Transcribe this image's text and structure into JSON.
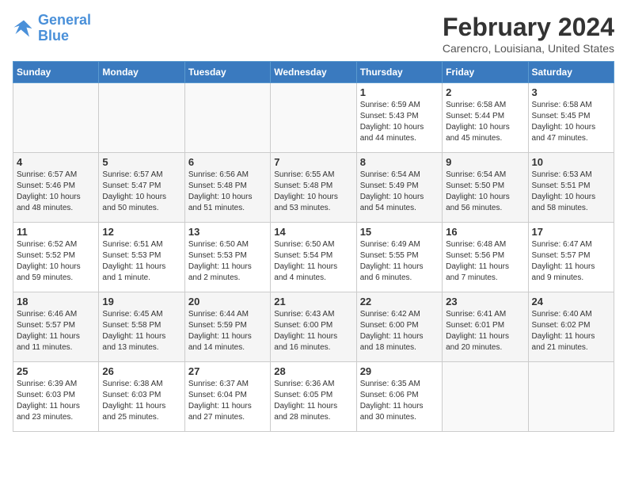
{
  "header": {
    "logo_line1": "General",
    "logo_line2": "Blue",
    "month": "February 2024",
    "location": "Carencro, Louisiana, United States"
  },
  "days_of_week": [
    "Sunday",
    "Monday",
    "Tuesday",
    "Wednesday",
    "Thursday",
    "Friday",
    "Saturday"
  ],
  "weeks": [
    [
      {
        "day": "",
        "info": ""
      },
      {
        "day": "",
        "info": ""
      },
      {
        "day": "",
        "info": ""
      },
      {
        "day": "",
        "info": ""
      },
      {
        "day": "1",
        "info": "Sunrise: 6:59 AM\nSunset: 5:43 PM\nDaylight: 10 hours\nand 44 minutes."
      },
      {
        "day": "2",
        "info": "Sunrise: 6:58 AM\nSunset: 5:44 PM\nDaylight: 10 hours\nand 45 minutes."
      },
      {
        "day": "3",
        "info": "Sunrise: 6:58 AM\nSunset: 5:45 PM\nDaylight: 10 hours\nand 47 minutes."
      }
    ],
    [
      {
        "day": "4",
        "info": "Sunrise: 6:57 AM\nSunset: 5:46 PM\nDaylight: 10 hours\nand 48 minutes."
      },
      {
        "day": "5",
        "info": "Sunrise: 6:57 AM\nSunset: 5:47 PM\nDaylight: 10 hours\nand 50 minutes."
      },
      {
        "day": "6",
        "info": "Sunrise: 6:56 AM\nSunset: 5:48 PM\nDaylight: 10 hours\nand 51 minutes."
      },
      {
        "day": "7",
        "info": "Sunrise: 6:55 AM\nSunset: 5:48 PM\nDaylight: 10 hours\nand 53 minutes."
      },
      {
        "day": "8",
        "info": "Sunrise: 6:54 AM\nSunset: 5:49 PM\nDaylight: 10 hours\nand 54 minutes."
      },
      {
        "day": "9",
        "info": "Sunrise: 6:54 AM\nSunset: 5:50 PM\nDaylight: 10 hours\nand 56 minutes."
      },
      {
        "day": "10",
        "info": "Sunrise: 6:53 AM\nSunset: 5:51 PM\nDaylight: 10 hours\nand 58 minutes."
      }
    ],
    [
      {
        "day": "11",
        "info": "Sunrise: 6:52 AM\nSunset: 5:52 PM\nDaylight: 10 hours\nand 59 minutes."
      },
      {
        "day": "12",
        "info": "Sunrise: 6:51 AM\nSunset: 5:53 PM\nDaylight: 11 hours\nand 1 minute."
      },
      {
        "day": "13",
        "info": "Sunrise: 6:50 AM\nSunset: 5:53 PM\nDaylight: 11 hours\nand 2 minutes."
      },
      {
        "day": "14",
        "info": "Sunrise: 6:50 AM\nSunset: 5:54 PM\nDaylight: 11 hours\nand 4 minutes."
      },
      {
        "day": "15",
        "info": "Sunrise: 6:49 AM\nSunset: 5:55 PM\nDaylight: 11 hours\nand 6 minutes."
      },
      {
        "day": "16",
        "info": "Sunrise: 6:48 AM\nSunset: 5:56 PM\nDaylight: 11 hours\nand 7 minutes."
      },
      {
        "day": "17",
        "info": "Sunrise: 6:47 AM\nSunset: 5:57 PM\nDaylight: 11 hours\nand 9 minutes."
      }
    ],
    [
      {
        "day": "18",
        "info": "Sunrise: 6:46 AM\nSunset: 5:57 PM\nDaylight: 11 hours\nand 11 minutes."
      },
      {
        "day": "19",
        "info": "Sunrise: 6:45 AM\nSunset: 5:58 PM\nDaylight: 11 hours\nand 13 minutes."
      },
      {
        "day": "20",
        "info": "Sunrise: 6:44 AM\nSunset: 5:59 PM\nDaylight: 11 hours\nand 14 minutes."
      },
      {
        "day": "21",
        "info": "Sunrise: 6:43 AM\nSunset: 6:00 PM\nDaylight: 11 hours\nand 16 minutes."
      },
      {
        "day": "22",
        "info": "Sunrise: 6:42 AM\nSunset: 6:00 PM\nDaylight: 11 hours\nand 18 minutes."
      },
      {
        "day": "23",
        "info": "Sunrise: 6:41 AM\nSunset: 6:01 PM\nDaylight: 11 hours\nand 20 minutes."
      },
      {
        "day": "24",
        "info": "Sunrise: 6:40 AM\nSunset: 6:02 PM\nDaylight: 11 hours\nand 21 minutes."
      }
    ],
    [
      {
        "day": "25",
        "info": "Sunrise: 6:39 AM\nSunset: 6:03 PM\nDaylight: 11 hours\nand 23 minutes."
      },
      {
        "day": "26",
        "info": "Sunrise: 6:38 AM\nSunset: 6:03 PM\nDaylight: 11 hours\nand 25 minutes."
      },
      {
        "day": "27",
        "info": "Sunrise: 6:37 AM\nSunset: 6:04 PM\nDaylight: 11 hours\nand 27 minutes."
      },
      {
        "day": "28",
        "info": "Sunrise: 6:36 AM\nSunset: 6:05 PM\nDaylight: 11 hours\nand 28 minutes."
      },
      {
        "day": "29",
        "info": "Sunrise: 6:35 AM\nSunset: 6:06 PM\nDaylight: 11 hours\nand 30 minutes."
      },
      {
        "day": "",
        "info": ""
      },
      {
        "day": "",
        "info": ""
      }
    ]
  ]
}
